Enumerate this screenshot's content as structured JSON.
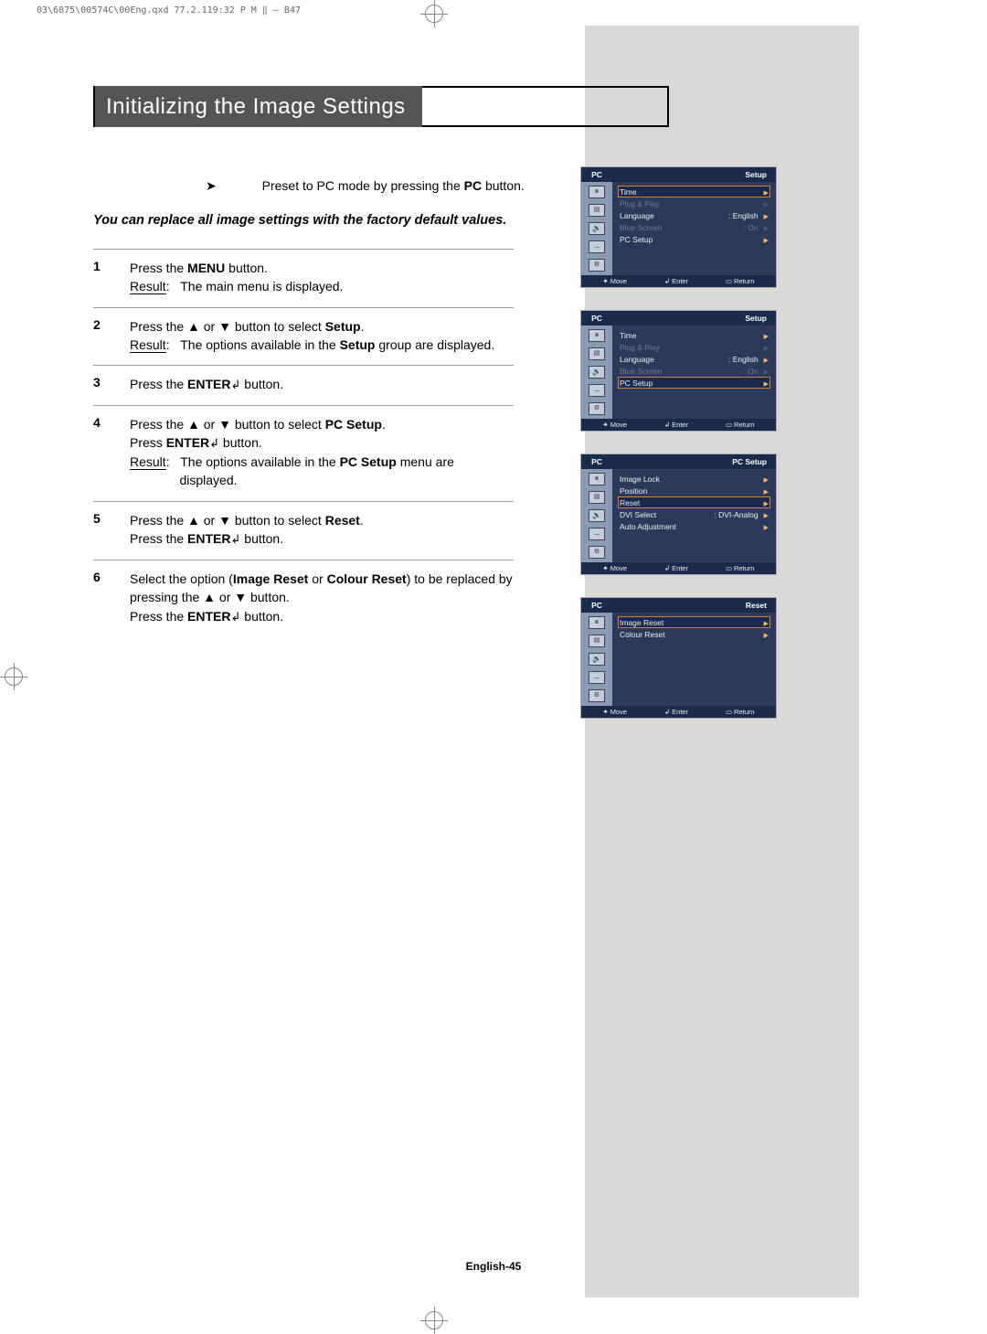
{
  "header_fileinfo": "03\\6875\\00574C\\00Eng.qxd  77.2.119:32 P M ‖ — B47",
  "title": "Initializing the Image Settings",
  "preset_line": {
    "prefix": "Preset to PC mode by pressing the ",
    "button": "PC",
    "suffix": " button."
  },
  "subtitle": "You can replace all image settings with the factory default values.",
  "steps": [
    {
      "num": "1",
      "html": "Press the <b>MENU</b> button.<br><span class='result'>Result</span>: &nbsp;&nbsp;The main menu is displayed."
    },
    {
      "num": "2",
      "html": "Press the ▲ or ▼ button to select <b>Setup</b>.<br><span class='result'>Result</span>: &nbsp;&nbsp;The options available in the <b>Setup</b> group are displayed."
    },
    {
      "num": "3",
      "html": "Press the <b>ENTER</b><span class='enter-icon'>↲</span> button."
    },
    {
      "num": "4",
      "html": "Press the ▲ or ▼ button to select <b>PC Setup</b>.<br>Press <b>ENTER</b><span class='enter-icon'>↲</span> button.<br><span class='result'>Result</span>: &nbsp;&nbsp;The options available in the <b>PC Setup</b> menu are<br>&nbsp;&nbsp;&nbsp;&nbsp;&nbsp;&nbsp;&nbsp;&nbsp;&nbsp;&nbsp;&nbsp;&nbsp;&nbsp;&nbsp;displayed."
    },
    {
      "num": "5",
      "html": "Press the ▲ or ▼ button to select <b>Reset</b>.<br>Press the <b>ENTER</b><span class='enter-icon'>↲</span> button."
    },
    {
      "num": "6",
      "html": "Select the option (<b>Image Reset</b> or <b>Colour Reset</b>) to be replaced by pressing the ▲ or ▼ button.<br>Press the <b>ENTER</b><span class='enter-icon'>↲</span> button."
    }
  ],
  "footer": "English-45",
  "osd": {
    "pc_label": "PC",
    "footer_move": "Move",
    "footer_enter": "Enter",
    "footer_return": "Return",
    "screens": [
      {
        "title": "Setup",
        "rows": [
          {
            "label": "Time",
            "val": "",
            "sel": true,
            "dim": false
          },
          {
            "label": "Plug & Play",
            "val": "",
            "sel": false,
            "dim": true
          },
          {
            "label": "Language",
            "val": ": English",
            "sel": false,
            "dim": false
          },
          {
            "label": "Blue Screen",
            "val": ": On",
            "sel": false,
            "dim": true
          },
          {
            "label": "PC Setup",
            "val": "",
            "sel": false,
            "dim": false
          }
        ]
      },
      {
        "title": "Setup",
        "rows": [
          {
            "label": "Time",
            "val": "",
            "sel": false,
            "dim": false
          },
          {
            "label": "Plug & Play",
            "val": "",
            "sel": false,
            "dim": true
          },
          {
            "label": "Language",
            "val": ": English",
            "sel": false,
            "dim": false
          },
          {
            "label": "Blue Screen",
            "val": ": On",
            "sel": false,
            "dim": true
          },
          {
            "label": "PC Setup",
            "val": "",
            "sel": true,
            "dim": false
          }
        ]
      },
      {
        "title": "PC Setup",
        "rows": [
          {
            "label": "Image Lock",
            "val": "",
            "sel": false,
            "dim": false
          },
          {
            "label": "Position",
            "val": "",
            "sel": false,
            "dim": false
          },
          {
            "label": "Reset",
            "val": "",
            "sel": true,
            "dim": false
          },
          {
            "label": "DVI Select",
            "val": ": DVI-Analog",
            "sel": false,
            "dim": false
          },
          {
            "label": "Auto Adjustment",
            "val": "",
            "sel": false,
            "dim": false
          }
        ]
      },
      {
        "title": "Reset",
        "rows": [
          {
            "label": "Image Reset",
            "val": "",
            "sel": true,
            "dim": false
          },
          {
            "label": "Colour Reset",
            "val": "",
            "sel": false,
            "dim": false
          }
        ]
      }
    ]
  }
}
